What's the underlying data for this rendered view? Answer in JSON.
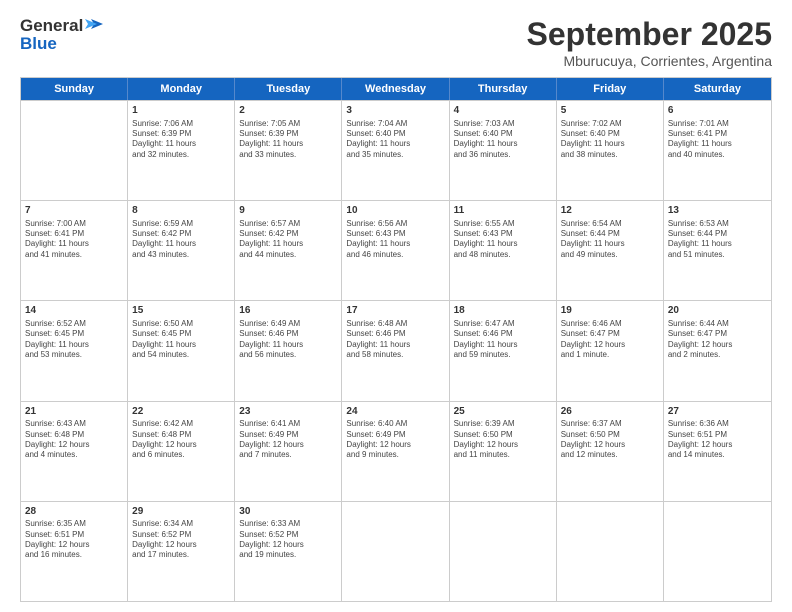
{
  "logo": {
    "line1": "General",
    "line2": "Blue"
  },
  "title": "September 2025",
  "subtitle": "Mburucuya, Corrientes, Argentina",
  "header_days": [
    "Sunday",
    "Monday",
    "Tuesday",
    "Wednesday",
    "Thursday",
    "Friday",
    "Saturday"
  ],
  "weeks": [
    [
      {
        "day": "",
        "info": ""
      },
      {
        "day": "1",
        "info": "Sunrise: 7:06 AM\nSunset: 6:39 PM\nDaylight: 11 hours\nand 32 minutes."
      },
      {
        "day": "2",
        "info": "Sunrise: 7:05 AM\nSunset: 6:39 PM\nDaylight: 11 hours\nand 33 minutes."
      },
      {
        "day": "3",
        "info": "Sunrise: 7:04 AM\nSunset: 6:40 PM\nDaylight: 11 hours\nand 35 minutes."
      },
      {
        "day": "4",
        "info": "Sunrise: 7:03 AM\nSunset: 6:40 PM\nDaylight: 11 hours\nand 36 minutes."
      },
      {
        "day": "5",
        "info": "Sunrise: 7:02 AM\nSunset: 6:40 PM\nDaylight: 11 hours\nand 38 minutes."
      },
      {
        "day": "6",
        "info": "Sunrise: 7:01 AM\nSunset: 6:41 PM\nDaylight: 11 hours\nand 40 minutes."
      }
    ],
    [
      {
        "day": "7",
        "info": "Sunrise: 7:00 AM\nSunset: 6:41 PM\nDaylight: 11 hours\nand 41 minutes."
      },
      {
        "day": "8",
        "info": "Sunrise: 6:59 AM\nSunset: 6:42 PM\nDaylight: 11 hours\nand 43 minutes."
      },
      {
        "day": "9",
        "info": "Sunrise: 6:57 AM\nSunset: 6:42 PM\nDaylight: 11 hours\nand 44 minutes."
      },
      {
        "day": "10",
        "info": "Sunrise: 6:56 AM\nSunset: 6:43 PM\nDaylight: 11 hours\nand 46 minutes."
      },
      {
        "day": "11",
        "info": "Sunrise: 6:55 AM\nSunset: 6:43 PM\nDaylight: 11 hours\nand 48 minutes."
      },
      {
        "day": "12",
        "info": "Sunrise: 6:54 AM\nSunset: 6:44 PM\nDaylight: 11 hours\nand 49 minutes."
      },
      {
        "day": "13",
        "info": "Sunrise: 6:53 AM\nSunset: 6:44 PM\nDaylight: 11 hours\nand 51 minutes."
      }
    ],
    [
      {
        "day": "14",
        "info": "Sunrise: 6:52 AM\nSunset: 6:45 PM\nDaylight: 11 hours\nand 53 minutes."
      },
      {
        "day": "15",
        "info": "Sunrise: 6:50 AM\nSunset: 6:45 PM\nDaylight: 11 hours\nand 54 minutes."
      },
      {
        "day": "16",
        "info": "Sunrise: 6:49 AM\nSunset: 6:46 PM\nDaylight: 11 hours\nand 56 minutes."
      },
      {
        "day": "17",
        "info": "Sunrise: 6:48 AM\nSunset: 6:46 PM\nDaylight: 11 hours\nand 58 minutes."
      },
      {
        "day": "18",
        "info": "Sunrise: 6:47 AM\nSunset: 6:46 PM\nDaylight: 11 hours\nand 59 minutes."
      },
      {
        "day": "19",
        "info": "Sunrise: 6:46 AM\nSunset: 6:47 PM\nDaylight: 12 hours\nand 1 minute."
      },
      {
        "day": "20",
        "info": "Sunrise: 6:44 AM\nSunset: 6:47 PM\nDaylight: 12 hours\nand 2 minutes."
      }
    ],
    [
      {
        "day": "21",
        "info": "Sunrise: 6:43 AM\nSunset: 6:48 PM\nDaylight: 12 hours\nand 4 minutes."
      },
      {
        "day": "22",
        "info": "Sunrise: 6:42 AM\nSunset: 6:48 PM\nDaylight: 12 hours\nand 6 minutes."
      },
      {
        "day": "23",
        "info": "Sunrise: 6:41 AM\nSunset: 6:49 PM\nDaylight: 12 hours\nand 7 minutes."
      },
      {
        "day": "24",
        "info": "Sunrise: 6:40 AM\nSunset: 6:49 PM\nDaylight: 12 hours\nand 9 minutes."
      },
      {
        "day": "25",
        "info": "Sunrise: 6:39 AM\nSunset: 6:50 PM\nDaylight: 12 hours\nand 11 minutes."
      },
      {
        "day": "26",
        "info": "Sunrise: 6:37 AM\nSunset: 6:50 PM\nDaylight: 12 hours\nand 12 minutes."
      },
      {
        "day": "27",
        "info": "Sunrise: 6:36 AM\nSunset: 6:51 PM\nDaylight: 12 hours\nand 14 minutes."
      }
    ],
    [
      {
        "day": "28",
        "info": "Sunrise: 6:35 AM\nSunset: 6:51 PM\nDaylight: 12 hours\nand 16 minutes."
      },
      {
        "day": "29",
        "info": "Sunrise: 6:34 AM\nSunset: 6:52 PM\nDaylight: 12 hours\nand 17 minutes."
      },
      {
        "day": "30",
        "info": "Sunrise: 6:33 AM\nSunset: 6:52 PM\nDaylight: 12 hours\nand 19 minutes."
      },
      {
        "day": "",
        "info": ""
      },
      {
        "day": "",
        "info": ""
      },
      {
        "day": "",
        "info": ""
      },
      {
        "day": "",
        "info": ""
      }
    ]
  ]
}
